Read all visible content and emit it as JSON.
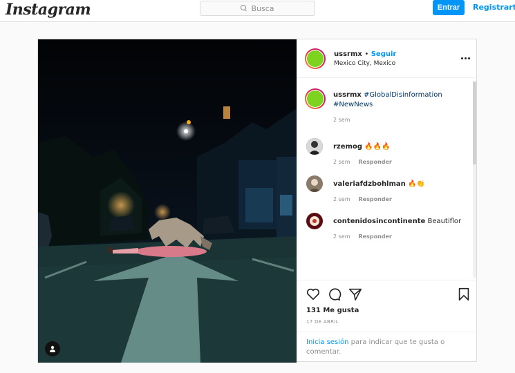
{
  "brand": {
    "logo_text": "Instagram"
  },
  "nav": {
    "search_placeholder": "Busca",
    "login_label": "Entrar",
    "register_label": "Registrarte"
  },
  "post": {
    "username": "ussrmx",
    "separator": "•",
    "follow_label": "Seguir",
    "location": "Mexico City, Mexico",
    "more_icon": "more-horizontal-icon",
    "caption": {
      "username": "ussrmx",
      "hashtags": [
        "#GlobalDisinformation",
        "#NewNews"
      ],
      "time": "2 sem"
    },
    "comments": [
      {
        "username": "rzemog",
        "text": "🔥🔥🔥",
        "time": "2 sem",
        "reply_label": "Responder"
      },
      {
        "username": "valeriafdzbohlman",
        "text": "🔥👏",
        "time": "2 sem",
        "reply_label": "Responder"
      },
      {
        "username": "contenidosincontinente",
        "text": "Beautiflor",
        "time": "2 sem",
        "reply_label": "Responder"
      }
    ],
    "likes_text": "131 Me gusta",
    "date_text": "17 DE ABRIL",
    "login_prompt": {
      "link_text": "Inicia sesión",
      "rest_text": "para indicar que te gusta o comentar."
    },
    "actions": [
      "heart-icon",
      "comment-icon",
      "share-icon",
      "bookmark-icon"
    ]
  },
  "colors": {
    "accent": "#0095f6",
    "avatar_fill": "#7ed321",
    "border": "#dbdbdb"
  }
}
